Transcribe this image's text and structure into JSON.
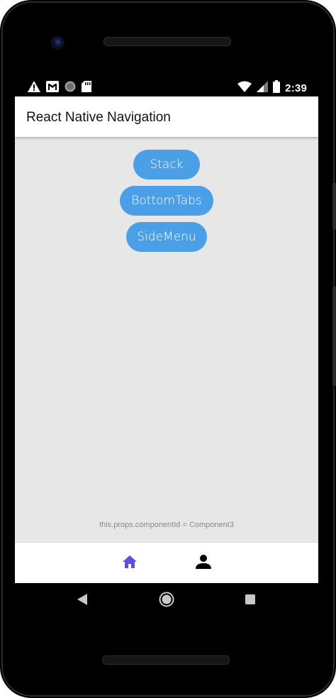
{
  "status_bar": {
    "time": "2:39",
    "left_icons": [
      "warning-icon",
      "gmail-icon",
      "circle-icon",
      "sd-card-icon"
    ],
    "right_icons": [
      "wifi-icon",
      "signal-icon",
      "battery-icon"
    ]
  },
  "topbar": {
    "title": "React Native Navigation"
  },
  "buttons": {
    "stack": "Stack",
    "bottom_tabs": "BottomTabs",
    "side_menu": "SideMenu"
  },
  "footer": {
    "component_id": "this.props.componentId = Component3"
  },
  "bottom_tabs": {
    "items": [
      {
        "icon": "home-icon",
        "selected": true
      },
      {
        "icon": "person-icon",
        "selected": false
      }
    ]
  },
  "colors": {
    "button": "#4a9fe7",
    "tab_selected": "#5b52e3",
    "screen_bg": "#e7e7e7"
  },
  "android_nav": {
    "keys": [
      "back-icon",
      "home-circle-icon",
      "recents-icon"
    ]
  }
}
